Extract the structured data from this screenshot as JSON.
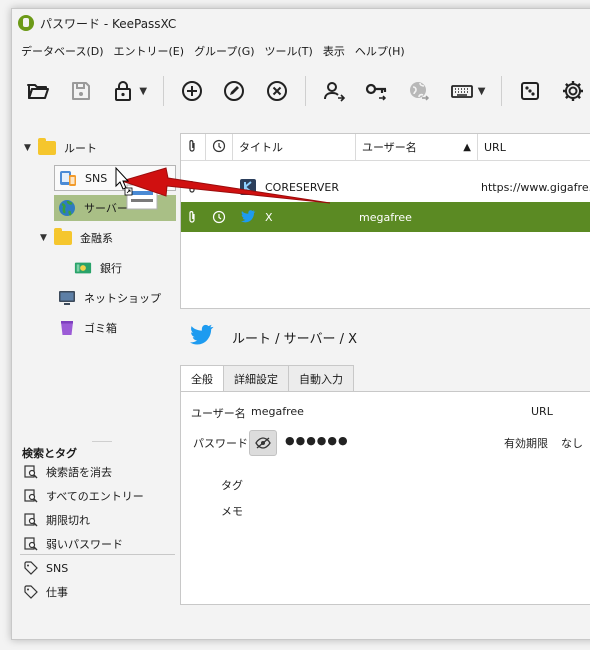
{
  "window": {
    "title": "パスワード - KeePassXC"
  },
  "menubar": {
    "items": [
      "データベース(D)",
      "エントリー(E)",
      "グループ(G)",
      "ツール(T)",
      "表示",
      "ヘルプ(H)"
    ]
  },
  "toolbar": {
    "buttons": [
      {
        "icon": "open-folder-icon"
      },
      {
        "icon": "save-icon"
      },
      {
        "icon": "lock-icon"
      },
      {
        "icon": "add-entry-icon"
      },
      {
        "icon": "edit-entry-icon"
      },
      {
        "icon": "delete-entry-icon"
      },
      {
        "icon": "copy-username-icon"
      },
      {
        "icon": "copy-password-icon"
      },
      {
        "icon": "open-url-icon"
      },
      {
        "icon": "autotype-keyboard-icon"
      },
      {
        "icon": "password-generator-icon"
      },
      {
        "icon": "settings-icon"
      }
    ]
  },
  "tree": {
    "root": "ルート",
    "items": [
      {
        "label": "SNS",
        "icon": "phone-tablet-icon"
      },
      {
        "label": "サーバー",
        "icon": "globe-icon"
      },
      {
        "label": "金融系",
        "icon": "folder-icon"
      },
      {
        "label": "銀行",
        "icon": "banknote-icon"
      },
      {
        "label": "ネットショップ",
        "icon": "monitor-icon"
      },
      {
        "label": "ゴミ箱",
        "icon": "trash-icon"
      }
    ]
  },
  "search_tags": {
    "header": "検索とタグ",
    "searches": [
      "検索語を消去",
      "すべてのエントリー",
      "期限切れ",
      "弱いパスワード"
    ],
    "tags": [
      "SNS",
      "仕事"
    ]
  },
  "table": {
    "headers": [
      "タイトル",
      "ユーザー名",
      "URL"
    ],
    "rows": [
      {
        "title": "CORESERVER",
        "username": "",
        "url": "https://www.gigafre..."
      },
      {
        "title": "X",
        "username": "megafree",
        "url": ""
      }
    ]
  },
  "details": {
    "path": "ルート / サーバー / X",
    "tabs": [
      "全般",
      "詳細設定",
      "自動入力"
    ],
    "fields": {
      "username_label": "ユーザー名",
      "username_value": "megafree",
      "password_label": "パスワード",
      "password_value": "●●●●●●",
      "url_label": "URL",
      "expiry_label": "有効期限",
      "expiry_value": "なし",
      "tags_label": "タグ",
      "notes_label": "メモ"
    }
  },
  "colors": {
    "selected_row": "#5b8a23",
    "group_highlight": "#a9bf86",
    "arrow": "#d01010",
    "twitter_blue": "#1d9bf0"
  }
}
